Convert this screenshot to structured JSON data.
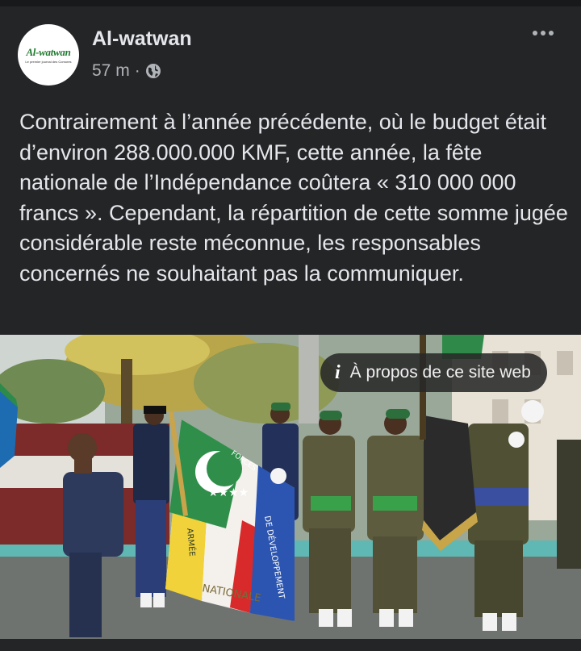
{
  "post": {
    "page_name": "Al-watwan",
    "avatar_text": "Al-watwan",
    "avatar_subtext": "Le premier journal des Comores",
    "time": "57 m",
    "separator": "·",
    "visibility_icon": "globe-icon",
    "more_icon": "more-options-icon",
    "body": "Contrairement à l’année précédente, où le budget était d’environ 288.000.000 KMF, cette année, la fête nationale de l’Indépendance coûtera « 310 000 000 francs ». Cependant, la répartition de cette somme jugée considérable reste méconnue, les responsables concernés ne souhaitant pas la communiquer."
  },
  "media": {
    "about_label": "À propos de ce site web",
    "about_icon": "info-icon",
    "flag_text_left": "ARMÉE",
    "flag_text_bottom": "NATIONALE",
    "flag_text_right": "DE DÉVELOPPEMENT",
    "flag_text_top": "FORCES"
  }
}
